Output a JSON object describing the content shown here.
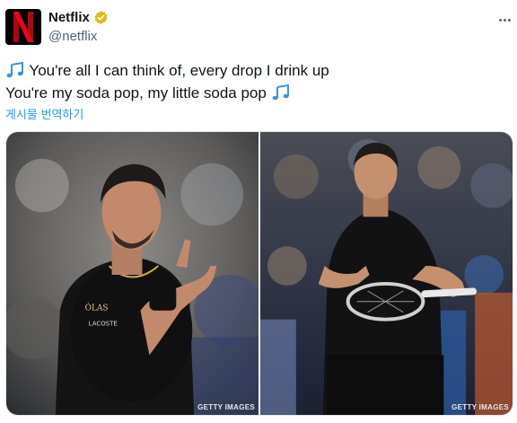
{
  "account": {
    "display_name": "Netflix",
    "handle": "@netflix",
    "verified_badge": "verified-gold-icon",
    "brand_color": "#e50914"
  },
  "tweet": {
    "line1": "You're all I can think of, every drop I drink up",
    "line2": "You're my soda pop, my little soda pop",
    "emoji": "musical-notes-icon",
    "translate_label": "게시물 번역하기"
  },
  "media": {
    "images": [
      {
        "alt": "tennis-player-gesture-photo",
        "credit": "GETTY IMAGES"
      },
      {
        "alt": "tennis-player-racket-photo",
        "credit": "GETTY IMAGES"
      }
    ]
  },
  "colors": {
    "link": "#1d9bf0",
    "secondary": "#536471"
  }
}
